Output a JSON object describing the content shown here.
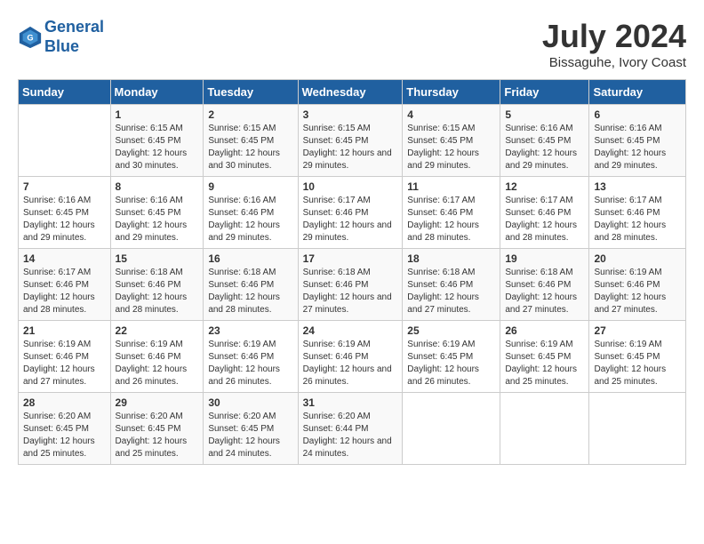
{
  "header": {
    "logo_line1": "General",
    "logo_line2": "Blue",
    "month": "July 2024",
    "location": "Bissaguhe, Ivory Coast"
  },
  "weekdays": [
    "Sunday",
    "Monday",
    "Tuesday",
    "Wednesday",
    "Thursday",
    "Friday",
    "Saturday"
  ],
  "weeks": [
    [
      {
        "day": "",
        "sunrise": "",
        "sunset": "",
        "daylight": ""
      },
      {
        "day": "1",
        "sunrise": "Sunrise: 6:15 AM",
        "sunset": "Sunset: 6:45 PM",
        "daylight": "Daylight: 12 hours and 30 minutes."
      },
      {
        "day": "2",
        "sunrise": "Sunrise: 6:15 AM",
        "sunset": "Sunset: 6:45 PM",
        "daylight": "Daylight: 12 hours and 30 minutes."
      },
      {
        "day": "3",
        "sunrise": "Sunrise: 6:15 AM",
        "sunset": "Sunset: 6:45 PM",
        "daylight": "Daylight: 12 hours and 29 minutes."
      },
      {
        "day": "4",
        "sunrise": "Sunrise: 6:15 AM",
        "sunset": "Sunset: 6:45 PM",
        "daylight": "Daylight: 12 hours and 29 minutes."
      },
      {
        "day": "5",
        "sunrise": "Sunrise: 6:16 AM",
        "sunset": "Sunset: 6:45 PM",
        "daylight": "Daylight: 12 hours and 29 minutes."
      },
      {
        "day": "6",
        "sunrise": "Sunrise: 6:16 AM",
        "sunset": "Sunset: 6:45 PM",
        "daylight": "Daylight: 12 hours and 29 minutes."
      }
    ],
    [
      {
        "day": "7",
        "sunrise": "Sunrise: 6:16 AM",
        "sunset": "Sunset: 6:45 PM",
        "daylight": "Daylight: 12 hours and 29 minutes."
      },
      {
        "day": "8",
        "sunrise": "Sunrise: 6:16 AM",
        "sunset": "Sunset: 6:45 PM",
        "daylight": "Daylight: 12 hours and 29 minutes."
      },
      {
        "day": "9",
        "sunrise": "Sunrise: 6:16 AM",
        "sunset": "Sunset: 6:46 PM",
        "daylight": "Daylight: 12 hours and 29 minutes."
      },
      {
        "day": "10",
        "sunrise": "Sunrise: 6:17 AM",
        "sunset": "Sunset: 6:46 PM",
        "daylight": "Daylight: 12 hours and 29 minutes."
      },
      {
        "day": "11",
        "sunrise": "Sunrise: 6:17 AM",
        "sunset": "Sunset: 6:46 PM",
        "daylight": "Daylight: 12 hours and 28 minutes."
      },
      {
        "day": "12",
        "sunrise": "Sunrise: 6:17 AM",
        "sunset": "Sunset: 6:46 PM",
        "daylight": "Daylight: 12 hours and 28 minutes."
      },
      {
        "day": "13",
        "sunrise": "Sunrise: 6:17 AM",
        "sunset": "Sunset: 6:46 PM",
        "daylight": "Daylight: 12 hours and 28 minutes."
      }
    ],
    [
      {
        "day": "14",
        "sunrise": "Sunrise: 6:17 AM",
        "sunset": "Sunset: 6:46 PM",
        "daylight": "Daylight: 12 hours and 28 minutes."
      },
      {
        "day": "15",
        "sunrise": "Sunrise: 6:18 AM",
        "sunset": "Sunset: 6:46 PM",
        "daylight": "Daylight: 12 hours and 28 minutes."
      },
      {
        "day": "16",
        "sunrise": "Sunrise: 6:18 AM",
        "sunset": "Sunset: 6:46 PM",
        "daylight": "Daylight: 12 hours and 28 minutes."
      },
      {
        "day": "17",
        "sunrise": "Sunrise: 6:18 AM",
        "sunset": "Sunset: 6:46 PM",
        "daylight": "Daylight: 12 hours and 27 minutes."
      },
      {
        "day": "18",
        "sunrise": "Sunrise: 6:18 AM",
        "sunset": "Sunset: 6:46 PM",
        "daylight": "Daylight: 12 hours and 27 minutes."
      },
      {
        "day": "19",
        "sunrise": "Sunrise: 6:18 AM",
        "sunset": "Sunset: 6:46 PM",
        "daylight": "Daylight: 12 hours and 27 minutes."
      },
      {
        "day": "20",
        "sunrise": "Sunrise: 6:19 AM",
        "sunset": "Sunset: 6:46 PM",
        "daylight": "Daylight: 12 hours and 27 minutes."
      }
    ],
    [
      {
        "day": "21",
        "sunrise": "Sunrise: 6:19 AM",
        "sunset": "Sunset: 6:46 PM",
        "daylight": "Daylight: 12 hours and 27 minutes."
      },
      {
        "day": "22",
        "sunrise": "Sunrise: 6:19 AM",
        "sunset": "Sunset: 6:46 PM",
        "daylight": "Daylight: 12 hours and 26 minutes."
      },
      {
        "day": "23",
        "sunrise": "Sunrise: 6:19 AM",
        "sunset": "Sunset: 6:46 PM",
        "daylight": "Daylight: 12 hours and 26 minutes."
      },
      {
        "day": "24",
        "sunrise": "Sunrise: 6:19 AM",
        "sunset": "Sunset: 6:46 PM",
        "daylight": "Daylight: 12 hours and 26 minutes."
      },
      {
        "day": "25",
        "sunrise": "Sunrise: 6:19 AM",
        "sunset": "Sunset: 6:45 PM",
        "daylight": "Daylight: 12 hours and 26 minutes."
      },
      {
        "day": "26",
        "sunrise": "Sunrise: 6:19 AM",
        "sunset": "Sunset: 6:45 PM",
        "daylight": "Daylight: 12 hours and 25 minutes."
      },
      {
        "day": "27",
        "sunrise": "Sunrise: 6:19 AM",
        "sunset": "Sunset: 6:45 PM",
        "daylight": "Daylight: 12 hours and 25 minutes."
      }
    ],
    [
      {
        "day": "28",
        "sunrise": "Sunrise: 6:20 AM",
        "sunset": "Sunset: 6:45 PM",
        "daylight": "Daylight: 12 hours and 25 minutes."
      },
      {
        "day": "29",
        "sunrise": "Sunrise: 6:20 AM",
        "sunset": "Sunset: 6:45 PM",
        "daylight": "Daylight: 12 hours and 25 minutes."
      },
      {
        "day": "30",
        "sunrise": "Sunrise: 6:20 AM",
        "sunset": "Sunset: 6:45 PM",
        "daylight": "Daylight: 12 hours and 24 minutes."
      },
      {
        "day": "31",
        "sunrise": "Sunrise: 6:20 AM",
        "sunset": "Sunset: 6:44 PM",
        "daylight": "Daylight: 12 hours and 24 minutes."
      },
      {
        "day": "",
        "sunrise": "",
        "sunset": "",
        "daylight": ""
      },
      {
        "day": "",
        "sunrise": "",
        "sunset": "",
        "daylight": ""
      },
      {
        "day": "",
        "sunrise": "",
        "sunset": "",
        "daylight": ""
      }
    ]
  ]
}
